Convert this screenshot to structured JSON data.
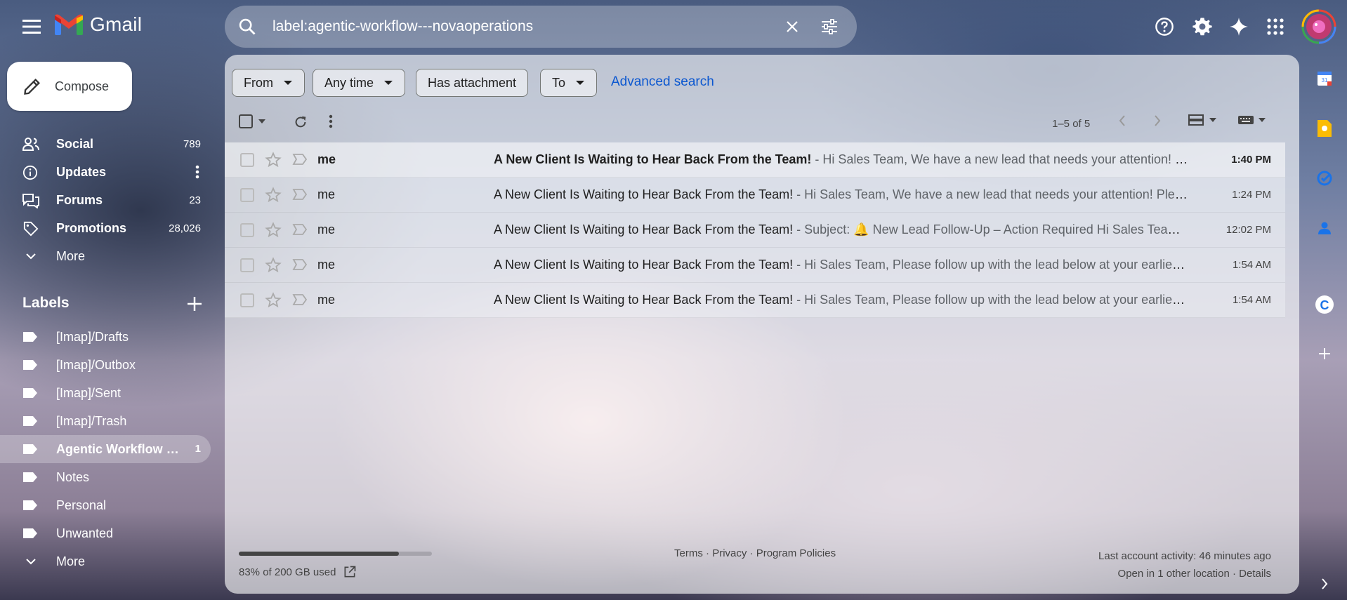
{
  "app": {
    "name": "Gmail"
  },
  "search": {
    "query": "label:agentic-workflow---novaoperations"
  },
  "compose": {
    "label": "Compose"
  },
  "nav": [
    {
      "name": "Social",
      "count": "789"
    },
    {
      "name": "Updates",
      "count": ""
    },
    {
      "name": "Forums",
      "count": "23"
    },
    {
      "name": "Promotions",
      "count": "28,026"
    }
  ],
  "nav_more": "More",
  "labels_title": "Labels",
  "labels": [
    {
      "name": "[Imap]/Drafts",
      "count": ""
    },
    {
      "name": "[Imap]/Outbox",
      "count": ""
    },
    {
      "name": "[Imap]/Sent",
      "count": ""
    },
    {
      "name": "[Imap]/Trash",
      "count": ""
    },
    {
      "name": "Agentic Workflow - NovaOperations",
      "count": "1"
    },
    {
      "name": "Notes",
      "count": ""
    },
    {
      "name": "Personal",
      "count": ""
    },
    {
      "name": "Unwanted",
      "count": ""
    }
  ],
  "labels_more": "More",
  "filters": {
    "from": "From",
    "any_time": "Any time",
    "has_attachment": "Has attachment",
    "to": "To",
    "advanced": "Advanced search"
  },
  "pagination": {
    "range": "1–5 of 5"
  },
  "emails": [
    {
      "sender": "me",
      "subject": "A New Client Is Waiting to Hear Back From the Team!",
      "snippet": " - Hi Sales Team, We have a new lead that needs your attention! Please follow up",
      "time": "1:40 PM",
      "unread": true
    },
    {
      "sender": "me",
      "subject": "A New Client Is Waiting to Hear Back From the Team!",
      "snippet": " - Hi Sales Team, We have a new lead that needs your attention! Please follow up",
      "time": "1:24 PM",
      "unread": false
    },
    {
      "sender": "me",
      "subject": "A New Client Is Waiting to Hear Back From the Team!",
      "snippet": " - Subject: 🔔 New Lead Follow-Up – Action Required Hi Sales Team, Please follow up",
      "time": "12:02 PM",
      "unread": false
    },
    {
      "sender": "me",
      "subject": "A New Client Is Waiting to Hear Back From the Team!",
      "snippet": " - Hi Sales Team, Please follow up with the lead below at your earliest convenience",
      "time": "1:54 AM",
      "unread": false
    },
    {
      "sender": "me",
      "subject": "A New Client Is Waiting to Hear Back From the Team!",
      "snippet": " - Hi Sales Team, Please follow up with the lead below at your earliest convenience",
      "time": "1:54 AM",
      "unread": false
    }
  ],
  "footer": {
    "storage": "83% of 200 GB used",
    "storage_fraction": 0.83,
    "terms": "Terms",
    "privacy": "Privacy",
    "policies": "Program Policies",
    "sep": " · ",
    "activity": "Last account activity: 46 minutes ago",
    "other_location": "Open in 1 other location · Details"
  },
  "colors": {
    "accent": "#0b57d0",
    "gmail_red": "#ea4335"
  }
}
